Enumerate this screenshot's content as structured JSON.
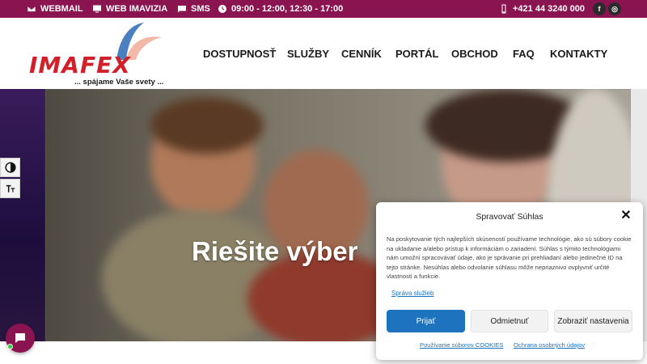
{
  "topbar": {
    "webmail": "WEBMAIL",
    "web_imavizia": "WEB IMAVIZIA",
    "sms": "SMS",
    "hours": "09:00 - 12:00, 12:30 - 17:00",
    "phone": "+421 44 3240 000",
    "facebook_glyph": "f",
    "instagram_glyph": "◎"
  },
  "logo": {
    "text": "IMAFEX",
    "tagline": "... spájame Vaše svety ..."
  },
  "nav": [
    "DOSTUPNOSŤ",
    "SLUŽBY",
    "CENNÍK",
    "PORTÁL",
    "OBCHOD",
    "FAQ",
    "KONTAKTY"
  ],
  "hero": {
    "title": "Riešite výber"
  },
  "cookie": {
    "title": "Spravovať Súhlas",
    "close": "✕",
    "body": "Na poskytovanie tých najlepších skúseností používame technológie, ako sú súbory cookie na ukladanie a/alebo prístup k informáciám o zariadení. Súhlas s týmito technológiami nám umožní spracovávať údaje, ako je správanie pri prehliadaní alebo jedinečné ID na tejto stránke. Nesúhlas alebo odvolanie súhlasu môže nepriaznivo ovplyvniť určité vlastnosti a funkcie.",
    "manage_link": "Správa služieb",
    "accept": "Prijať",
    "deny": "Odmietnuť",
    "settings": "Zobraziť nastavenia",
    "cookie_policy": "Používanie súborov COOKIES",
    "privacy": "Ochrana osobných údajov"
  },
  "colors": {
    "brand": "#8a1450",
    "logo_red": "#d21f2a",
    "accept_blue": "#1e73be"
  }
}
